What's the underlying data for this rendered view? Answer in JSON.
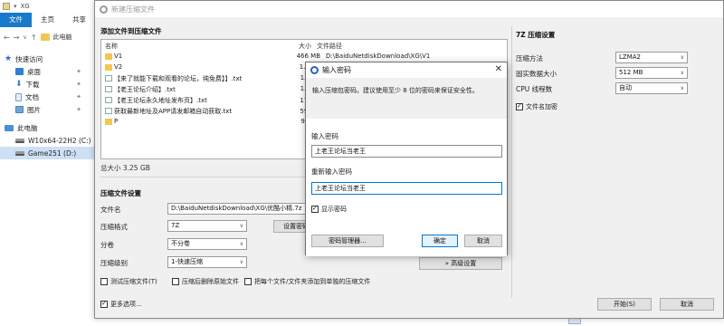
{
  "explorer": {
    "title": "XG",
    "ribbon_tabs": [
      "文件",
      "主页",
      "共享"
    ],
    "address_segment": "此电脑",
    "nav": [
      {
        "label": "快速访问"
      },
      {
        "label": "桌面"
      },
      {
        "label": "下载"
      },
      {
        "label": "文档"
      },
      {
        "label": "图片"
      },
      {
        "label": "此电脑"
      },
      {
        "label": "W10x64-22H2 (C:)"
      },
      {
        "label": "Game251 (D:)"
      }
    ]
  },
  "archive_dialog": {
    "title": "新建压缩文件",
    "files_section": "添加文件到压缩文件",
    "columns": {
      "name": "名称",
      "size": "大小",
      "path": "文件路径"
    },
    "files": [
      {
        "name": "V1",
        "type": "folder",
        "size": "466 MB",
        "path": "D:\\BaiduNetdiskDownload\\XG\\V1"
      },
      {
        "name": "V2",
        "type": "folder",
        "size": "1.84 G",
        "path": ""
      },
      {
        "name": "【来了就能下载和观看的论坛，纯免费】】.txt",
        "type": "file",
        "size": "1.06 K",
        "path": ""
      },
      {
        "name": "【老王论坛介绍】.txt",
        "type": "file",
        "size": "1.06 K",
        "path": ""
      },
      {
        "name": "【老王论坛永久地址发布页】.txt",
        "type": "file",
        "size": "170 字",
        "path": ""
      },
      {
        "name": "获取最新地址及APP请发邮箱自动获取.txt",
        "type": "file",
        "size": "592 字",
        "path": ""
      },
      {
        "name": "P",
        "type": "folder",
        "size": "977 M",
        "path": ""
      }
    ],
    "total_size": "总大小 3.25 GB",
    "settings_section": "压缩文件设置",
    "filename_label": "文件名",
    "filename_value": "D:\\BaiduNetdiskDownload\\XG\\优酷小精.7z",
    "format_label": "压缩格式",
    "format_value": "7Z",
    "password_button": "设置密码(P)",
    "split_label": "分卷",
    "split_value": "不分卷",
    "level_label": "压缩级别",
    "level_value": "1-快速压缩",
    "advanced_button": "» 高级设置",
    "options": [
      {
        "label": "测试压缩文件(T)",
        "checked": false
      },
      {
        "label": "压缩后删除原始文件",
        "checked": false
      },
      {
        "label": "把每个文件/文件夹添加到单独的压缩文件",
        "checked": false
      }
    ],
    "more_options": {
      "label": "更多选项...",
      "checked": true
    },
    "start_button": "开始(S)",
    "cancel_button": "取消",
    "panel_7z": {
      "title": "7Z 压缩设置",
      "method_label": "压缩方法",
      "method_value": "LZMA2",
      "dict_label": "固实数据大小",
      "dict_value": "512 MB",
      "threads_label": "CPU 线程数",
      "threads_value": "自动",
      "encrypt_names": {
        "label": "文件名加密",
        "checked": true
      }
    }
  },
  "password_dialog": {
    "title": "输入密码",
    "hint": "输入压缩包密码。建议使用至少 8 位的密码来保证安全性。",
    "password_label": "输入密码",
    "password_value": "上老王论坛当老王",
    "confirm_label": "重新输入密码",
    "confirm_value": "上老王论坛当老王",
    "show_password": {
      "label": "显示密码",
      "checked": true
    },
    "manager_button": "密码管理器...",
    "ok_button": "确定",
    "cancel_button": "取消"
  }
}
